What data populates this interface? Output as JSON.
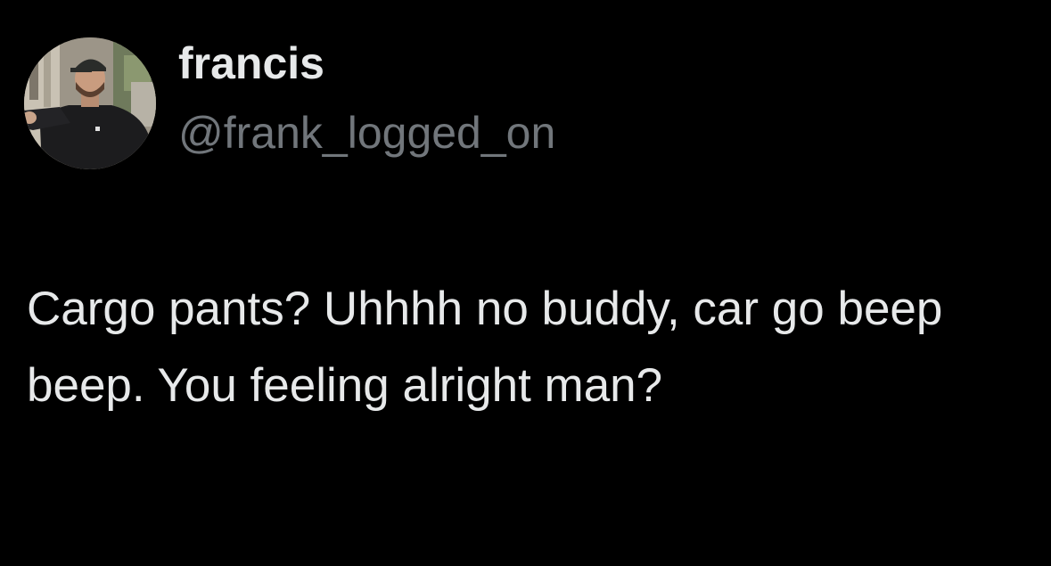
{
  "tweet": {
    "author": {
      "display_name": "francis",
      "handle": "@frank_logged_on",
      "avatar_icon": "profile-photo"
    },
    "text": "Cargo pants? Uhhhh no buddy, car go beep beep. You feeling alright man?"
  },
  "colors": {
    "background": "#000000",
    "primary_text": "#e7e9ea",
    "secondary_text": "#71767b"
  }
}
